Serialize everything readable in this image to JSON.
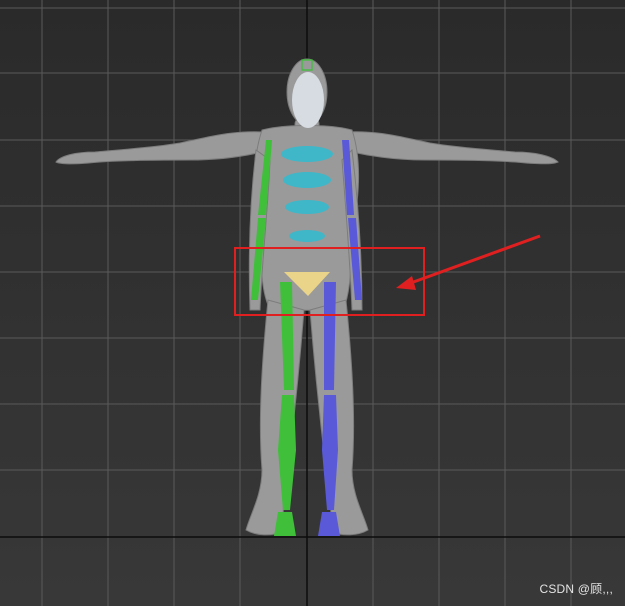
{
  "viewport": {
    "label": "perspective-viewport",
    "background_top": "#2a2a2a",
    "background_bottom": "#383838",
    "grid_color": "#5a5a5a",
    "axis_color": "#0c0c0c"
  },
  "model": {
    "mesh_color": "#9a9a9a",
    "head_color": "#d6dce2",
    "left_chain_color": "#3fbf3a",
    "right_chain_color": "#5a5ad8",
    "spine_color": "#3fb7c8",
    "pelvis_color": "#e9d48a"
  },
  "annotation": {
    "box_color": "#e02020",
    "arrow_color": "#e02020"
  },
  "watermark": "CSDN @顾,,,"
}
